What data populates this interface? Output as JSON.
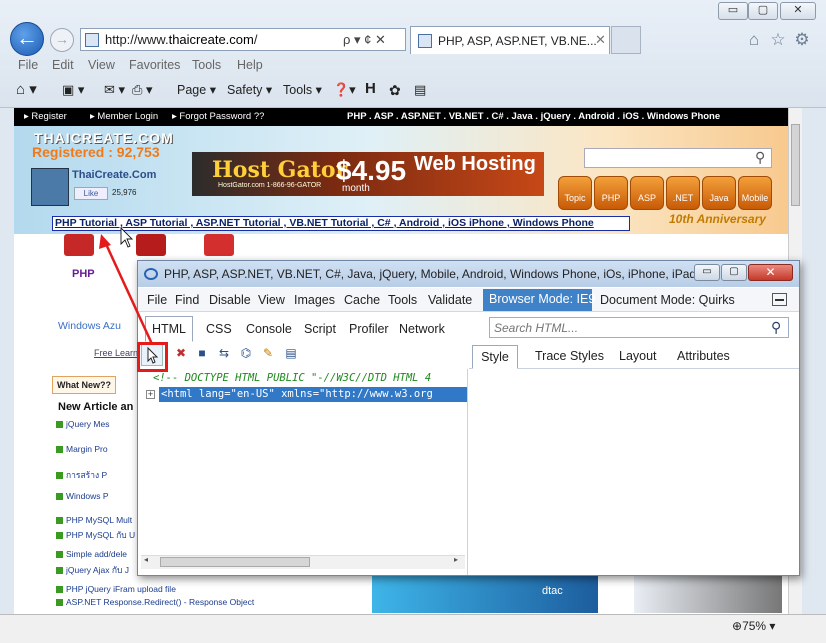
{
  "window": {
    "min": "▭",
    "max": "▢",
    "close": "✕"
  },
  "address": {
    "url_prefix": "http://www.",
    "url_domain": "thaicreate.com",
    "url_suffix": "/",
    "search_glyph": "ρ ▾ ¢ ✕"
  },
  "tab": {
    "title": "PHP, ASP, ASP.NET, VB.NE...",
    "close": "✕"
  },
  "ie_menu": [
    "File",
    "Edit",
    "View",
    "Favorites",
    "Tools",
    "Help"
  ],
  "command_bar": [
    {
      "label": "Page",
      "arrow": "▾"
    },
    {
      "label": "Safety",
      "arrow": "▾"
    },
    {
      "label": "Tools",
      "arrow": "▾"
    }
  ],
  "webpage": {
    "top_links": [
      "▸ Register",
      "▸ Member Login",
      "▸ Forgot Password ??"
    ],
    "top_nav": "PHP . ASP . ASP.NET . VB.NET . C# . Java . jQuery . Android . iOS . Windows Phone",
    "logo": "THAICREATE.COM",
    "registered": "Registered : 92,753",
    "fb_name": "ThaiCreate.Com",
    "fb_like": "Like",
    "fb_count": "25,976",
    "banner_brand": "Host Gator",
    "banner_price": "$4.95",
    "banner_tagline": "Web Hosting",
    "banner_phone": "HostGator.com 1-866-96-GATOR",
    "banner_month": "month",
    "categories": [
      "Topic",
      "PHP",
      "ASP",
      ".NET",
      "Java",
      "Mobile"
    ],
    "anniversary": "10th Anniversary",
    "tutorial_links": "PHP Tutorial , ASP Tutorial , ASP.NET Tutorial , VB.NET Tutorial , C# , Android , iOS iPhone , Windows Phone",
    "php_label": "PHP",
    "windows_azure": "Windows Azu",
    "free_learn": "Free Learn",
    "whats_new": "What New??",
    "new_articles_heading": "New Article an",
    "articles": [
      "jQuery Mes",
      "Margin Pro",
      "การสร้าง P",
      "Windows P",
      "PHP MySQL Mult",
      "PHP MySQL กับ U",
      "Simple add/dele",
      "jQuery Ajax กับ J",
      "PHP jQuery iFram upload file",
      "ASP.NET Response.Redirect() - Response Object"
    ],
    "ad_text": "dtac"
  },
  "devtools": {
    "title": "PHP, ASP, ASP.NET, VB.NET, C#, Java, jQuery, Mobile, Android, Windows Phone, iOs, iPhone, iPad...",
    "menu": [
      "File",
      "Find",
      "Disable",
      "View",
      "Images",
      "Cache",
      "Tools",
      "Validate"
    ],
    "browser_mode": "Browser Mode: IE9",
    "document_mode": "Document Mode: Quirks",
    "tabs": [
      "HTML",
      "CSS",
      "Console",
      "Script",
      "Profiler",
      "Network"
    ],
    "search_placeholder": "Search HTML...",
    "side_tabs": [
      "Style",
      "Trace Styles",
      "Layout",
      "Attributes"
    ],
    "tree_line1": "<!-- DOCTYPE HTML PUBLIC \"-//W3C//DTD HTML 4",
    "tree_line2": "<html lang=\"en-US\" xmlns=\"http://www.w3.org",
    "expander": "+",
    "scroll_left": "◂",
    "scroll_right": "▸"
  },
  "status": {
    "zoom": "75%"
  },
  "colors": {
    "accent": "#3f82c8",
    "highlight_red": "#e41b1b",
    "selected_node": "#3178c6"
  }
}
